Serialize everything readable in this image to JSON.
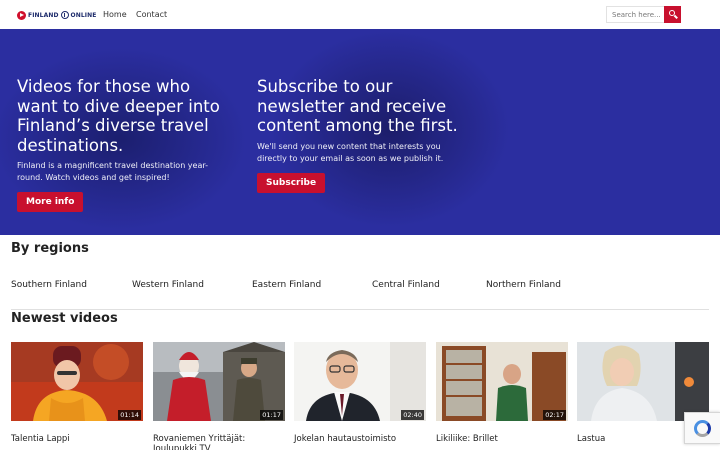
{
  "header": {
    "logo_left": "FINLAND",
    "logo_right": "ONLINE",
    "nav": [
      {
        "label": "Home"
      },
      {
        "label": "Contact"
      }
    ],
    "search_placeholder": "Search here..."
  },
  "hero": {
    "left": {
      "title": "Videos for those who want to dive deeper into Finland’s diverse travel destinations.",
      "description": "Finland is a magnificent travel destination year-round. Watch videos and get inspired!",
      "button": "More info"
    },
    "right": {
      "title": "Subscribe to our newsletter and receive content among the first.",
      "description": "We'll send you new content that interests you directly to your email as soon as we publish it.",
      "button": "Subscribe"
    }
  },
  "regions": {
    "title": "By regions",
    "items": [
      "Southern Finland",
      "Western Finland",
      "Eastern Finland",
      "Central Finland",
      "Northern Finland"
    ]
  },
  "videos": {
    "title": "Newest videos",
    "items": [
      {
        "title": "Talentia Lappi",
        "duration": "01:14"
      },
      {
        "title": "Rovaniemen Yrittäjät: Joulupukki TV",
        "duration": "01:17"
      },
      {
        "title": "Jokelan hautaustoimisto",
        "duration": "02:40"
      },
      {
        "title": "Likiliike: Brillet",
        "duration": "02:17"
      },
      {
        "title": "Lastua",
        "duration": ""
      }
    ]
  },
  "colors": {
    "accent": "#c8102e",
    "hero_bg": "#2b2ea0",
    "brand_navy": "#1d2b6b"
  }
}
